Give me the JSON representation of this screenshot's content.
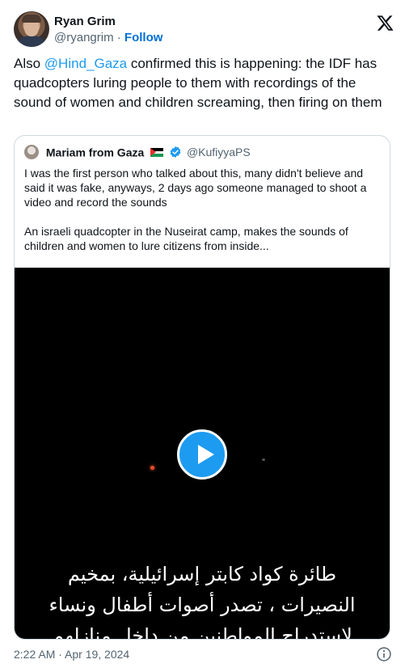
{
  "author": {
    "name": "Ryan Grim",
    "handle": "@ryangrim",
    "separator": "·",
    "follow_label": "Follow"
  },
  "tweet": {
    "prefix": "Also ",
    "mention": "@Hind_Gaza",
    "body": " confirmed this is happening: the IDF has quadcopters luring people to them with recordings of the sound of women and children screaming, then firing on them"
  },
  "quote": {
    "name": "Mariam from Gaza",
    "handle": "@KufiyyaPS",
    "paragraph1": "I was the first person who talked about this, many didn't believe and said it was fake, anyways, 2 days ago someone managed to shoot a video and record the sounds",
    "paragraph2": "An israeli quadcopter in the Nuseirat camp, makes the sounds of children and women to lure citizens from inside...",
    "video": {
      "subtitle_line1": "طائرة كواد كابتر إسرائيلية، بمخيم",
      "subtitle_line2": "النصيرات ، تصدر أصوات أطفال ونساء",
      "subtitle_line3": "لاستدراج المواطنين من داخل منازلهم"
    }
  },
  "footer": {
    "timestamp": "2:22 AM · Apr 19, 2024"
  },
  "colors": {
    "link": "#1d9bf0",
    "follow": "#006fd6",
    "play_button": "#1d9bf0",
    "secondary_text": "#536471"
  },
  "icons": {
    "logo": "x-logo-icon",
    "verified": "verified-badge-icon",
    "flag": "palestine-flag-icon",
    "play": "play-icon",
    "info": "info-icon"
  }
}
